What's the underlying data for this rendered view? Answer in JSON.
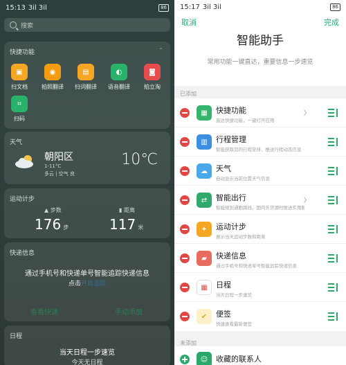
{
  "left": {
    "status": {
      "time": "15:13",
      "signal": "3il 3il",
      "battery": "86"
    },
    "search": {
      "placeholder": "搜索"
    },
    "quick": {
      "title": "快捷功能",
      "items": [
        {
          "label": "扫文档",
          "icon": "scan-document-icon",
          "color": "#f5a623"
        },
        {
          "label": "拍照翻译",
          "icon": "photo-translate-icon",
          "color": "#f39c12"
        },
        {
          "label": "扫词翻译",
          "icon": "word-translate-icon",
          "color": "#f5a623"
        },
        {
          "label": "语音翻译",
          "icon": "voice-translate-icon",
          "color": "#2ab26a"
        },
        {
          "label": "拍立淘",
          "icon": "camera-shop-icon",
          "color": "#e74c4c"
        },
        {
          "label": "扫码",
          "icon": "qr-scan-icon",
          "color": "#2ab26a"
        }
      ]
    },
    "weather": {
      "title": "天气",
      "city": "朝阳区",
      "range": "1-11°C",
      "desc": "多云 | 空气 良",
      "temp": "10℃"
    },
    "steps": {
      "title": "运动计步",
      "steps_label": "步数",
      "steps_value": "176",
      "steps_unit": "步",
      "distance_label": "距离",
      "distance_value": "117",
      "distance_unit": "米"
    },
    "express": {
      "title": "快递信息",
      "message": "通过手机号和快递单号智能追踪快递信息",
      "message2_prefix": "点击",
      "message2_link": "开启追踪",
      "btn_left": "查看快递",
      "btn_right": "手动添加"
    },
    "schedule": {
      "title": "日程",
      "message": "当天日程一步速览",
      "message2": "今天无日程"
    }
  },
  "right": {
    "status": {
      "time": "15:17",
      "signal": "3il 3il",
      "battery": "86"
    },
    "cancel": "取消",
    "done": "完成",
    "title": "智能助手",
    "subtitle": "常用功能一键直达，重要信息一步速览",
    "added_label": "已添加",
    "not_added_label": "未添加",
    "items": [
      {
        "name": "快捷功能",
        "desc": "直达快捷功能，一键打开应用",
        "icon": "quick-function-icon",
        "color": "#35b56b",
        "arrow": true
      },
      {
        "name": "行程管理",
        "desc": "智能获取您的行程安排，推送行程动态信息",
        "icon": "itinerary-icon",
        "color": "#3a8fe0",
        "arrow": false
      },
      {
        "name": "天气",
        "desc": "自动显示当前位置天气信息",
        "icon": "weather-cloud-icon",
        "color": "#49a8ea",
        "arrow": false
      },
      {
        "name": "智能出行",
        "desc": "智能规划通勤路线，国内外货源时推送实用服务",
        "icon": "smart-travel-icon",
        "color": "#2faa6a",
        "arrow": true
      },
      {
        "name": "运动计步",
        "desc": "展示当天运动步数和距离",
        "icon": "running-icon",
        "color": "#f5a623",
        "arrow": false
      },
      {
        "name": "快递信息",
        "desc": "通过手机号和快递单号智能追踪快递信息",
        "icon": "delivery-truck-icon",
        "color": "#e96a5e",
        "arrow": false
      },
      {
        "name": "日程",
        "desc": "当天日程一步速览",
        "icon": "calendar-icon",
        "color": "#ffffff",
        "arrow": false
      },
      {
        "name": "便签",
        "desc": "快速查看最新便签",
        "icon": "notes-icon",
        "color": "#f7d26a",
        "arrow": false
      }
    ],
    "not_added": [
      {
        "name": "收藏的联系人",
        "icon": "contacts-icon",
        "color": "#2aa86a"
      }
    ]
  }
}
